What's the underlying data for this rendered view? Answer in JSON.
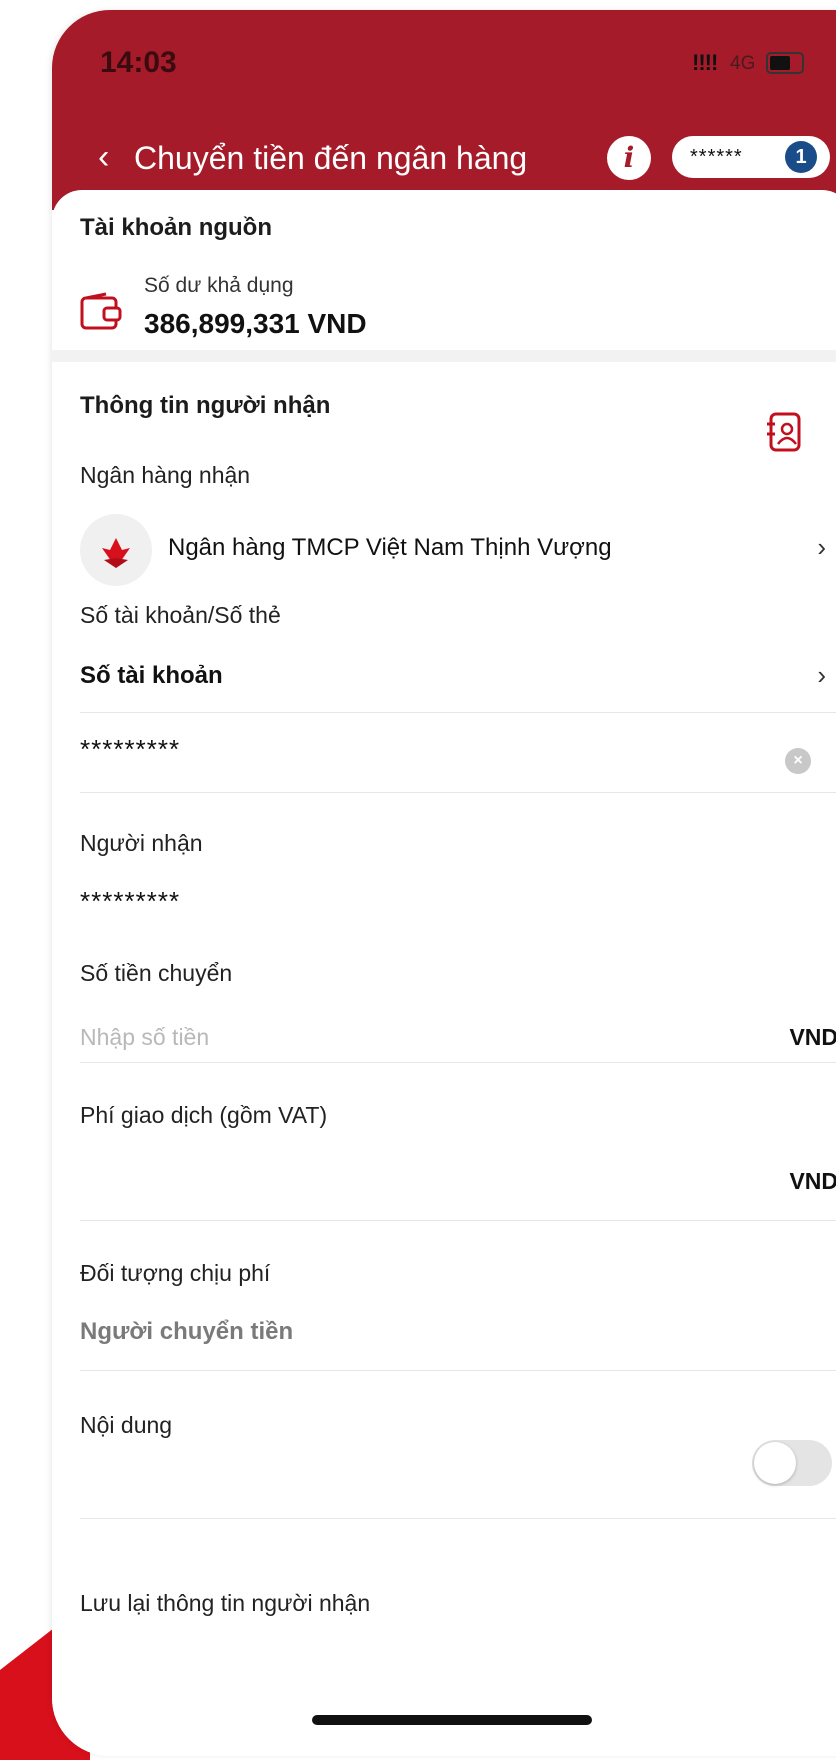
{
  "status_bar": {
    "time": "14:03",
    "signal": "!!!!",
    "network": "4G"
  },
  "header": {
    "back_icon": "‹",
    "title": "Chuyển tiền đến ngân hàng",
    "info_icon": "i",
    "account_mask": "******",
    "account_badge": "1"
  },
  "source_account": {
    "section_title": "Tài khoản nguồn",
    "balance_label": "Số dư khả dụng",
    "balance_value": "386,899,331 VND",
    "icon": "wallet-icon"
  },
  "recipient": {
    "section_title": "Thông tin người nhận",
    "contacts_icon": "contacts-book-icon",
    "bank_label": "Ngân hàng nhận",
    "bank_name": "Ngân hàng TMCP Việt Nam Thịnh Vượng",
    "account_type_label": "Số tài khoản/Số thẻ",
    "account_type_value": "Số tài khoản",
    "account_number": "*********",
    "recipient_label": "Người nhận",
    "recipient_value": "*********"
  },
  "amount": {
    "label": "Số tiền chuyển",
    "placeholder": "Nhập số tiền",
    "currency": "VND"
  },
  "fee": {
    "label": "Phí giao dịch (gồm VAT)",
    "currency": "VND"
  },
  "fee_payer": {
    "label": "Đối tượng chịu phí",
    "value": "Người chuyển tiền"
  },
  "content": {
    "label": "Nội dung"
  },
  "save_recipient": {
    "label": "Lưu lại thông tin người nhận",
    "enabled": false
  },
  "chevron": "›",
  "colors": {
    "header_bg": "#a51b29",
    "accent": "#d8101c",
    "badge": "#1a4c8a"
  }
}
